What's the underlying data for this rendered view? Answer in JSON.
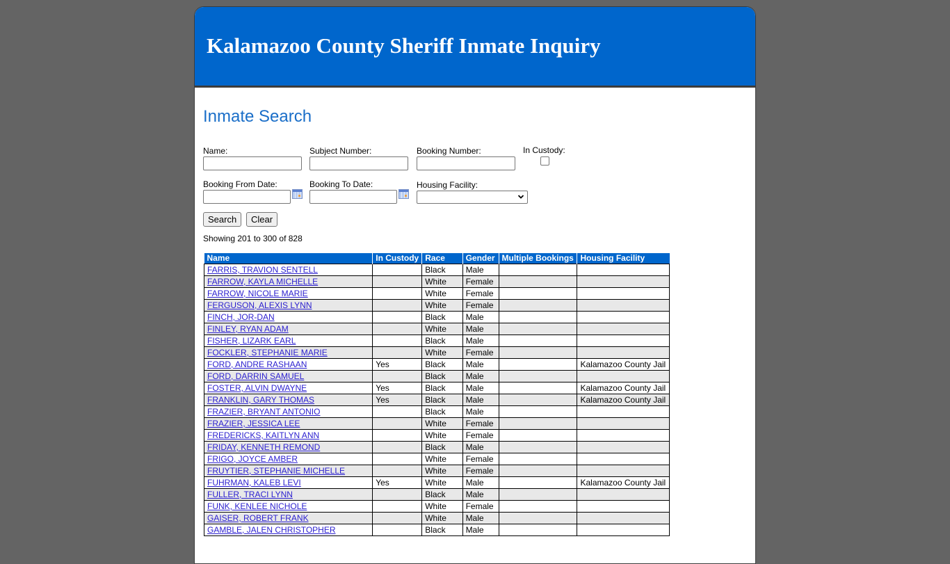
{
  "header": {
    "title": "Kalamazoo County Sheriff Inmate Inquiry"
  },
  "search": {
    "title": "Inmate Search",
    "fields": {
      "name": {
        "label": "Name:",
        "value": ""
      },
      "subject_number": {
        "label": "Subject Number:",
        "value": ""
      },
      "booking_number": {
        "label": "Booking Number:",
        "value": ""
      },
      "in_custody": {
        "label": "In Custody:",
        "checked": false
      },
      "booking_from_date": {
        "label": "Booking From Date:",
        "value": ""
      },
      "booking_to_date": {
        "label": "Booking To Date:",
        "value": ""
      },
      "housing_facility": {
        "label": "Housing Facility:",
        "selected": ""
      }
    },
    "buttons": {
      "search": "Search",
      "clear": "Clear"
    },
    "icons": {
      "calendar": "calendar-icon",
      "select_arrow": "chevron-down-icon"
    }
  },
  "results": {
    "status": "Showing 201 to 300 of 828",
    "columns": [
      "Name",
      "In Custody",
      "Race",
      "Gender",
      "Multiple Bookings",
      "Housing Facility"
    ],
    "rows": [
      {
        "name": "FARRIS, TRAVION SENTELL",
        "in_custody": "",
        "race": "Black",
        "gender": "Male",
        "multiple_bookings": "",
        "housing_facility": ""
      },
      {
        "name": "FARROW, KAYLA MICHELLE",
        "in_custody": "",
        "race": "White",
        "gender": "Female",
        "multiple_bookings": "",
        "housing_facility": ""
      },
      {
        "name": "FARROW, NICOLE MARIE",
        "in_custody": "",
        "race": "White",
        "gender": "Female",
        "multiple_bookings": "",
        "housing_facility": ""
      },
      {
        "name": "FERGUSON, ALEXIS LYNN",
        "in_custody": "",
        "race": "White",
        "gender": "Female",
        "multiple_bookings": "",
        "housing_facility": ""
      },
      {
        "name": "FINCH, JOR-DAN",
        "in_custody": "",
        "race": "Black",
        "gender": "Male",
        "multiple_bookings": "",
        "housing_facility": ""
      },
      {
        "name": "FINLEY, RYAN ADAM",
        "in_custody": "",
        "race": "White",
        "gender": "Male",
        "multiple_bookings": "",
        "housing_facility": ""
      },
      {
        "name": "FISHER, LIZARK EARL",
        "in_custody": "",
        "race": "Black",
        "gender": "Male",
        "multiple_bookings": "",
        "housing_facility": ""
      },
      {
        "name": "FOCKLER, STEPHANIE MARIE",
        "in_custody": "",
        "race": "White",
        "gender": "Female",
        "multiple_bookings": "",
        "housing_facility": ""
      },
      {
        "name": "FORD, ANDRE RASHAAN",
        "in_custody": "Yes",
        "race": "Black",
        "gender": "Male",
        "multiple_bookings": "",
        "housing_facility": "Kalamazoo County Jail"
      },
      {
        "name": "FORD, DARRIN SAMUEL",
        "in_custody": "",
        "race": "Black",
        "gender": "Male",
        "multiple_bookings": "",
        "housing_facility": ""
      },
      {
        "name": "FOSTER, ALVIN DWAYNE",
        "in_custody": "Yes",
        "race": "Black",
        "gender": "Male",
        "multiple_bookings": "",
        "housing_facility": "Kalamazoo County Jail"
      },
      {
        "name": "FRANKLIN, GARY THOMAS",
        "in_custody": "Yes",
        "race": "Black",
        "gender": "Male",
        "multiple_bookings": "",
        "housing_facility": "Kalamazoo County Jail"
      },
      {
        "name": "FRAZIER, BRYANT ANTONIO",
        "in_custody": "",
        "race": "Black",
        "gender": "Male",
        "multiple_bookings": "",
        "housing_facility": ""
      },
      {
        "name": "FRAZIER, JESSICA LEE",
        "in_custody": "",
        "race": "White",
        "gender": "Female",
        "multiple_bookings": "",
        "housing_facility": ""
      },
      {
        "name": "FREDERICKS, KAITLYN ANN",
        "in_custody": "",
        "race": "White",
        "gender": "Female",
        "multiple_bookings": "",
        "housing_facility": ""
      },
      {
        "name": "FRIDAY, KENNETH REMOND",
        "in_custody": "",
        "race": "Black",
        "gender": "Male",
        "multiple_bookings": "",
        "housing_facility": ""
      },
      {
        "name": "FRIGO, JOYCE AMBER",
        "in_custody": "",
        "race": "White",
        "gender": "Female",
        "multiple_bookings": "",
        "housing_facility": ""
      },
      {
        "name": "FRUYTIER, STEPHANIE MICHELLE",
        "in_custody": "",
        "race": "White",
        "gender": "Female",
        "multiple_bookings": "",
        "housing_facility": ""
      },
      {
        "name": "FUHRMAN, KALEB LEVI",
        "in_custody": "Yes",
        "race": "White",
        "gender": "Male",
        "multiple_bookings": "",
        "housing_facility": "Kalamazoo County Jail"
      },
      {
        "name": "FULLER, TRACI LYNN",
        "in_custody": "",
        "race": "Black",
        "gender": "Male",
        "multiple_bookings": "",
        "housing_facility": ""
      },
      {
        "name": "FUNK, KENLEE NICHOLE",
        "in_custody": "",
        "race": "White",
        "gender": "Female",
        "multiple_bookings": "",
        "housing_facility": ""
      },
      {
        "name": "GAISER, ROBERT FRANK",
        "in_custody": "",
        "race": "White",
        "gender": "Male",
        "multiple_bookings": "",
        "housing_facility": ""
      },
      {
        "name": "GAMBLE, JALEN CHRISTOPHER",
        "in_custody": "",
        "race": "Black",
        "gender": "Male",
        "multiple_bookings": "",
        "housing_facility": ""
      }
    ]
  },
  "colors": {
    "background": "#646464",
    "brand_blue": "#0066cc",
    "title_blue": "#1a6ec8",
    "link": "#2a1ecf",
    "alt_row": "#e8e8e8"
  }
}
